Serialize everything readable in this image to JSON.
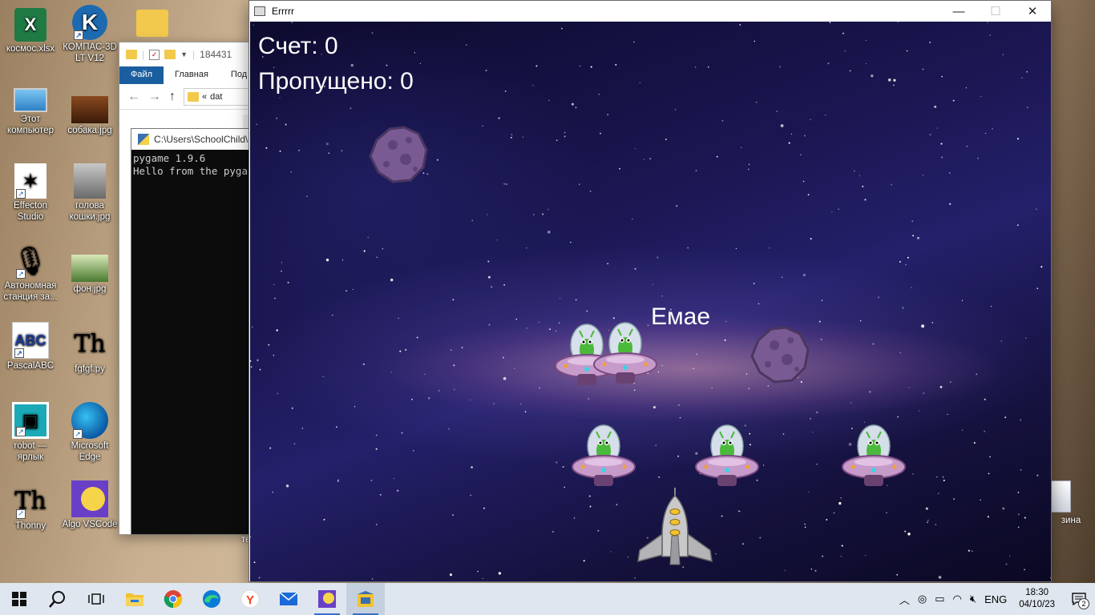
{
  "desktop": {
    "icons": [
      {
        "label": "космос.xlsx",
        "glyph": "X"
      },
      {
        "label": "КОМПАС-3D LT V12",
        "glyph": "K"
      },
      {
        "label": "Этот компьютер"
      },
      {
        "label": "собака.jpg"
      },
      {
        "label": "Effecton Studio",
        "glyph": "✶"
      },
      {
        "label": "голова кошки.jpg"
      },
      {
        "label": "Автономная станция за...",
        "glyph": "🎙"
      },
      {
        "label": "фон.jpg"
      },
      {
        "label": "PascalABC",
        "glyph": "ABC"
      },
      {
        "label": "fgfgf.py",
        "glyph": "Th"
      },
      {
        "label": "robot — ярлык",
        "glyph": "▣"
      },
      {
        "label": "Microsoft Edge"
      },
      {
        "label": "Thonny",
        "glyph": "Th"
      },
      {
        "label": "Algo VSCode"
      }
    ],
    "recycle_bin_label": "зина",
    "partial_label": "те"
  },
  "explorer": {
    "title": "184431",
    "tabs": [
      "Файл",
      "Главная",
      "Под"
    ],
    "address": "dat",
    "address_prefix": "«"
  },
  "console": {
    "title": "C:\\Users\\SchoolChild\\",
    "output": "pygame 1.9.6\nHello from the pyga"
  },
  "game_window": {
    "title": "Errrrr",
    "score_text": "Счет: 0",
    "missed_text": "Пропущено: 0",
    "floating_text": "Емае"
  },
  "taskbar": {
    "language": "ENG",
    "time": "18:30",
    "date": "04/10/23",
    "notification_count": "2"
  },
  "colors": {
    "taskbar_bg": "#dfe6ef",
    "explorer_file_tab": "#1b5e9f",
    "space_dark": "#14113c",
    "hud_text": "#ffffff"
  }
}
